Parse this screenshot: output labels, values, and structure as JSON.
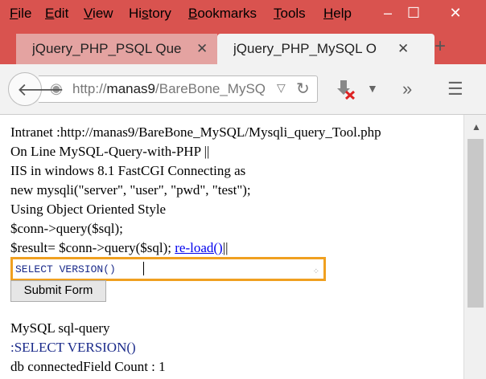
{
  "menu": {
    "items": [
      {
        "label": "File",
        "u": "F",
        "rest": "ile"
      },
      {
        "label": "Edit",
        "u": "E",
        "rest": "dit"
      },
      {
        "label": "View",
        "u": "V",
        "rest": "iew"
      },
      {
        "label": "History",
        "pre": "Hi",
        "u": "s",
        "rest": "tory"
      },
      {
        "label": "Bookmarks",
        "u": "B",
        "rest": "ookmarks"
      },
      {
        "label": "Tools",
        "u": "T",
        "rest": "ools"
      },
      {
        "label": "Help",
        "u": "H",
        "rest": "elp"
      }
    ]
  },
  "tabs": [
    {
      "label": "jQuery_PHP_PSQL Que"
    },
    {
      "label": "jQuery_PHP_MySQL O"
    }
  ],
  "nav": {
    "url_prefix": "http://",
    "url_host": "manas9",
    "url_path": "/BareBone_MySQ"
  },
  "content": {
    "lines": [
      "Intranet :http://manas9/BareBone_MySQL/Mysqli_query_Tool.php",
      "On Line MySQL-Query-with-PHP ||",
      "IIS in windows 8.1 FastCGI Connecting as",
      "new mysqli(\"server\", \"user\", \"pwd\", \"test\");",
      "Using Object Oriented Style",
      "$conn->query($sql);"
    ],
    "last_line_prefix": "$result= $conn->query($sql); ",
    "reload_link": "re-load()",
    "last_line_suffix": "||",
    "query_value": "SELECT VERSION()",
    "submit_label": "Submit Form",
    "results": {
      "heading": "MySQL sql-query",
      "query_echo": ":SELECT VERSION()",
      "field_count": "db connectedField Count : 1"
    }
  },
  "colors": {
    "titlebar": "#d9534f",
    "highlight_border": "#f0a020",
    "link": "#0000ee",
    "query_text": "#1a2a8a"
  }
}
